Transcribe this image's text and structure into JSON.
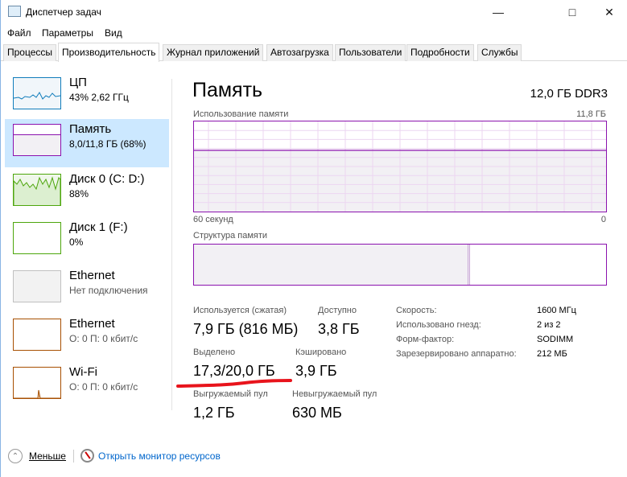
{
  "window": {
    "title": "Диспетчер задач",
    "icon": "task-manager-icon",
    "controls": [
      "minimize",
      "maximize",
      "close"
    ]
  },
  "menu": [
    "Файл",
    "Параметры",
    "Вид"
  ],
  "tabs": [
    "Процессы",
    "Производительность",
    "Журнал приложений",
    "Автозагрузка",
    "Пользователи",
    "Подробности",
    "Службы"
  ],
  "active_tab": "Производительность",
  "sidebar": [
    {
      "name": "ЦП",
      "sub": "43%  2,62 ГГц",
      "color": "#117dbb",
      "selected": false
    },
    {
      "name": "Память",
      "sub": "8,0/11,8 ГБ (68%)",
      "color": "#8b12ae",
      "selected": true
    },
    {
      "name": "Диск 0 (C: D:)",
      "sub": "88%",
      "color": "#4da60c",
      "selected": false
    },
    {
      "name": "Диск 1 (F:)",
      "sub": "0%",
      "color": "#4da60c",
      "selected": false
    },
    {
      "name": "Ethernet",
      "sub": "Нет подключения",
      "color": "#c0c0c0",
      "selected": false
    },
    {
      "name": "Ethernet",
      "sub": "О: 0 П: 0 кбит/с",
      "color": "#a74f01",
      "selected": false
    },
    {
      "name": "Wi-Fi",
      "sub": "О: 0 П: 0 кбит/с",
      "color": "#a74f01",
      "selected": false
    }
  ],
  "main": {
    "title": "Память",
    "spec": "12,0 ГБ DDR3",
    "usage_label": "Использование памяти",
    "usage_max": "11,8 ГБ",
    "usage_percent": 68,
    "time_left": "60 секунд",
    "time_right": "0",
    "composition_label": "Структура памяти",
    "composition_in_use_percent": 67,
    "stats": [
      {
        "label": "Используется (сжатая)",
        "value": "7,9 ГБ (816 МБ)"
      },
      {
        "label": "Доступно",
        "value": "3,8 ГБ"
      },
      {
        "label": "Выделено",
        "value": "17,3/20,0 ГБ"
      },
      {
        "label": "Кэшировано",
        "value": "3,9 ГБ"
      },
      {
        "label": "Выгружаемый пул",
        "value": "1,2 ГБ"
      },
      {
        "label": "Невыгружаемый пул",
        "value": "630 МБ"
      }
    ],
    "details": [
      {
        "key": "Скорость:",
        "value": "1600 МГц"
      },
      {
        "key": "Использовано гнезд:",
        "value": "2 из 2"
      },
      {
        "key": "Форм-фактор:",
        "value": "SODIMM"
      },
      {
        "key": "Зарезервировано аппаратно:",
        "value": "212 МБ"
      }
    ],
    "annotation_color": "#e8141c"
  },
  "footer": {
    "less": "Меньше",
    "monitor": "Открыть монитор ресурсов"
  }
}
